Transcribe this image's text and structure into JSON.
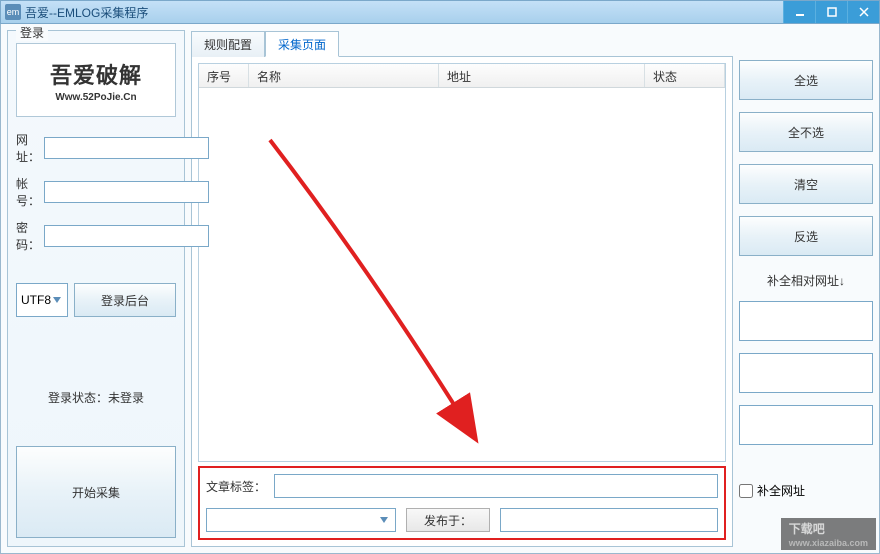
{
  "titlebar": {
    "icon_text": "em",
    "title": "吾爱--EMLOG采集程序"
  },
  "login": {
    "panel_title": "登录",
    "logo_text": "吾爱破解",
    "logo_url": "Www.52PoJie.Cn",
    "url_label": "网址：",
    "url_value": "",
    "account_label": "帐号：",
    "account_value": "",
    "password_label": "密码：",
    "password_value": "",
    "encoding": "UTF8",
    "login_button": "登录后台",
    "status": "登录状态：未登录",
    "start_button": "开始采集"
  },
  "tabs": {
    "rule": "规则配置",
    "collect": "采集页面"
  },
  "table": {
    "col_seq": "序号",
    "col_name": "名称",
    "col_addr": "地址",
    "col_status": "状态"
  },
  "bottom": {
    "tag_label": "文章标签：",
    "tag_value": "",
    "combo_value": "",
    "publish_label": "发布于：",
    "publish_value": ""
  },
  "right": {
    "select_all": "全选",
    "select_none": "全不选",
    "clear": "清空",
    "invert": "反选",
    "complete_label": "补全相对网址↓",
    "complete_check": "补全网址"
  },
  "watermark": {
    "main": "下载吧",
    "sub": "www.xiazaiba.com"
  }
}
